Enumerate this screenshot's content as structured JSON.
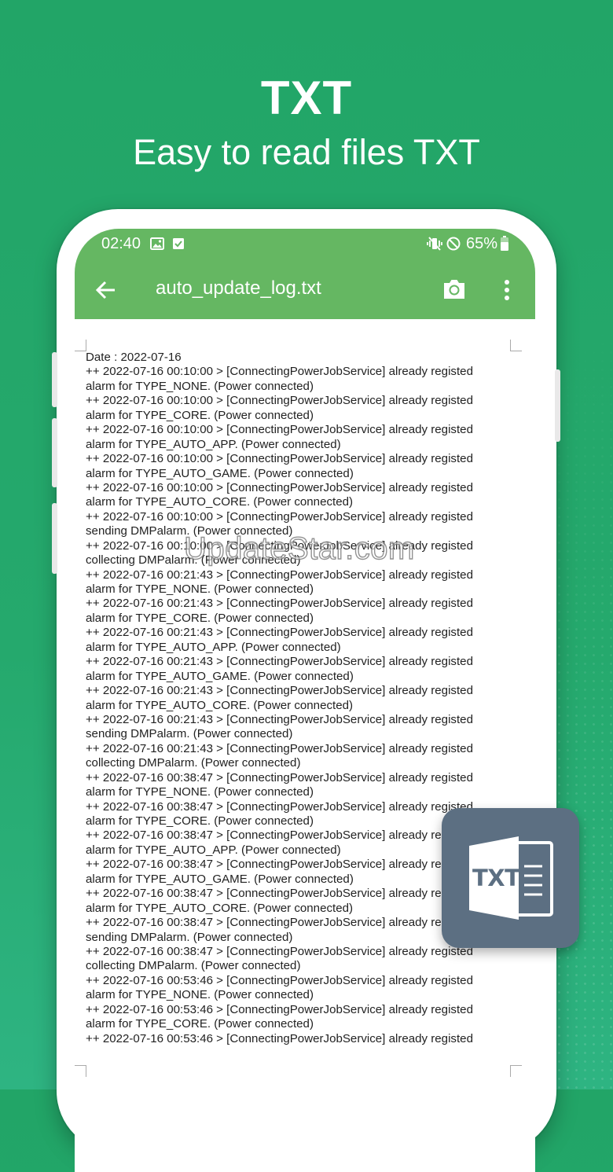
{
  "hero": {
    "title": "TXT",
    "subtitle": "Easy to read files TXT"
  },
  "statusbar": {
    "time": "02:40",
    "battery": "65%",
    "icons": [
      "image-icon",
      "check-notification-icon",
      "vibrate-icon",
      "do-not-disturb-icon",
      "battery-icon"
    ]
  },
  "appbar": {
    "title": "auto_update_log.txt",
    "icons": [
      "back-arrow-icon",
      "camera-icon",
      "more-vert-icon"
    ]
  },
  "log_lines": [
    "Date : 2022-07-16",
    "++ 2022-07-16 00:10:00 > [ConnectingPowerJobService] already registed",
    "alarm for TYPE_NONE. (Power connected)",
    "++ 2022-07-16 00:10:00 > [ConnectingPowerJobService] already registed",
    "alarm for TYPE_CORE. (Power connected)",
    "++ 2022-07-16 00:10:00 > [ConnectingPowerJobService] already registed",
    "alarm for TYPE_AUTO_APP. (Power connected)",
    "++ 2022-07-16 00:10:00 > [ConnectingPowerJobService] already registed",
    "alarm for TYPE_AUTO_GAME. (Power connected)",
    "++ 2022-07-16 00:10:00 > [ConnectingPowerJobService] already registed",
    "alarm for TYPE_AUTO_CORE. (Power connected)",
    "++ 2022-07-16 00:10:00 > [ConnectingPowerJobService] already registed",
    "sending DMPalarm. (Power connected)",
    "++ 2022-07-16 00:10:00 > [ConnectingPowerJobService] already registed",
    "collecting DMPalarm. (Power connected)",
    "++ 2022-07-16 00:21:43 > [ConnectingPowerJobService] already registed",
    "alarm for TYPE_NONE. (Power connected)",
    "++ 2022-07-16 00:21:43 > [ConnectingPowerJobService] already registed",
    "alarm for TYPE_CORE. (Power connected)",
    "++ 2022-07-16 00:21:43 > [ConnectingPowerJobService] already registed",
    "alarm for TYPE_AUTO_APP. (Power connected)",
    "++ 2022-07-16 00:21:43 > [ConnectingPowerJobService] already registed",
    "alarm for TYPE_AUTO_GAME. (Power connected)",
    "++ 2022-07-16 00:21:43 > [ConnectingPowerJobService] already registed",
    "alarm for TYPE_AUTO_CORE. (Power connected)",
    "++ 2022-07-16 00:21:43 > [ConnectingPowerJobService] already registed",
    "sending DMPalarm. (Power connected)",
    "++ 2022-07-16 00:21:43 > [ConnectingPowerJobService] already registed",
    "collecting DMPalarm. (Power connected)",
    "++ 2022-07-16 00:38:47 > [ConnectingPowerJobService] already registed",
    "alarm for TYPE_NONE. (Power connected)",
    "++ 2022-07-16 00:38:47 > [ConnectingPowerJobService] already registed",
    "alarm for TYPE_CORE. (Power connected)",
    "++ 2022-07-16 00:38:47 > [ConnectingPowerJobService] already re",
    "alarm for TYPE_AUTO_APP. (Power connected)",
    "++ 2022-07-16 00:38:47 > [ConnectingPowerJobService] already re",
    "alarm for TYPE_AUTO_GAME. (Power connected)",
    "++ 2022-07-16 00:38:47 > [ConnectingPowerJobService] already re",
    "alarm for TYPE_AUTO_CORE. (Power connected)",
    "++ 2022-07-16 00:38:47 > [ConnectingPowerJobService] already re",
    "sending DMPalarm. (Power connected)",
    "++ 2022-07-16 00:38:47 > [ConnectingPowerJobService] already registed",
    "collecting DMPalarm. (Power connected)",
    "++ 2022-07-16 00:53:46 > [ConnectingPowerJobService] already registed",
    "alarm for TYPE_NONE. (Power connected)",
    "++ 2022-07-16 00:53:46 > [ConnectingPowerJobService] already registed",
    "alarm for TYPE_CORE. (Power connected)",
    "++ 2022-07-16 00:53:46 > [ConnectingPowerJobService] already registed"
  ],
  "watermark": "UpdateStar.com",
  "badge": {
    "label": "TXT",
    "icon": "txt-file-icon"
  },
  "colors": {
    "background": "#22a567",
    "appbar": "#65b762",
    "badge": "#5c6f82",
    "text": "#222222"
  }
}
